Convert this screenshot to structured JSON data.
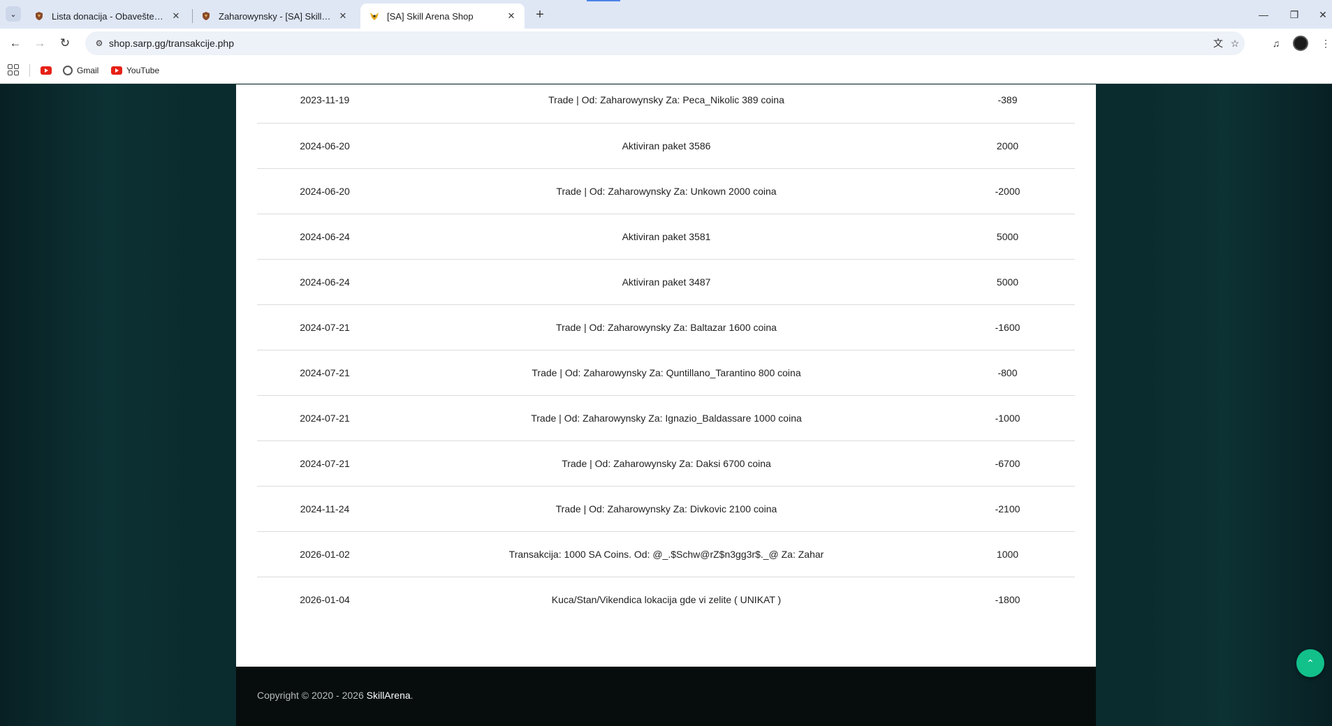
{
  "browser": {
    "tabs": [
      {
        "title": "Lista donacija - Obaveštenja - [SA] Skill Arena",
        "favicon": "shield-icon"
      },
      {
        "title": "Zaharowynsky - [SA] Skill Arena",
        "favicon": "shield-icon"
      },
      {
        "title": "[SA] Skill Arena Shop",
        "favicon": "bird-icon",
        "active": true
      }
    ],
    "url": "shop.sarp.gg/transakcije.php",
    "bookmarks": [
      {
        "label": "",
        "icon": "youtube-icon"
      },
      {
        "label": "Gmail",
        "icon": "globe-icon"
      },
      {
        "label": "YouTube",
        "icon": "youtube-icon"
      }
    ]
  },
  "transactions": [
    {
      "date": "2023-11-19",
      "description": "Trade | Od: Zaharowynsky Za: Peca_Nikolic 389 coina",
      "amount": "-389"
    },
    {
      "date": "2024-06-20",
      "description": "Aktiviran paket 3586",
      "amount": "2000"
    },
    {
      "date": "2024-06-20",
      "description": "Trade | Od: Zaharowynsky Za: Unkown 2000 coina",
      "amount": "-2000"
    },
    {
      "date": "2024-06-24",
      "description": "Aktiviran paket 3581",
      "amount": "5000"
    },
    {
      "date": "2024-06-24",
      "description": "Aktiviran paket 3487",
      "amount": "5000"
    },
    {
      "date": "2024-07-21",
      "description": "Trade | Od: Zaharowynsky Za: Baltazar 1600 coina",
      "amount": "-1600"
    },
    {
      "date": "2024-07-21",
      "description": "Trade | Od: Zaharowynsky Za: Quntillano_Tarantino 800 coina",
      "amount": "-800"
    },
    {
      "date": "2024-07-21",
      "description": "Trade | Od: Zaharowynsky Za: Ignazio_Baldassare 1000 coina",
      "amount": "-1000"
    },
    {
      "date": "2024-07-21",
      "description": "Trade | Od: Zaharowynsky Za: Daksi 6700 coina",
      "amount": "-6700"
    },
    {
      "date": "2024-11-24",
      "description": "Trade | Od: Zaharowynsky Za: Divkovic 2100 coina",
      "amount": "-2100"
    },
    {
      "date": "2026-01-02",
      "description": "Transakcija: 1000 SA Coins. Od: @_.$Schw@rZ$n3gg3r$._@ Za: Zahar",
      "amount": "1000"
    },
    {
      "date": "2026-01-04",
      "description": "Kuca/Stan/Vikendica lokacija gde vi zelite ( UNIKAT )",
      "amount": "-1800"
    }
  ],
  "footer": {
    "prefix": "Copyright © 2020 - 2026 ",
    "brand": "SkillArena",
    "suffix": "."
  },
  "colors": {
    "page_bg": "#0b2c2e",
    "card_bg": "#ffffff",
    "footer_bg": "#070d0d",
    "scroll_top": "#12c08a"
  }
}
